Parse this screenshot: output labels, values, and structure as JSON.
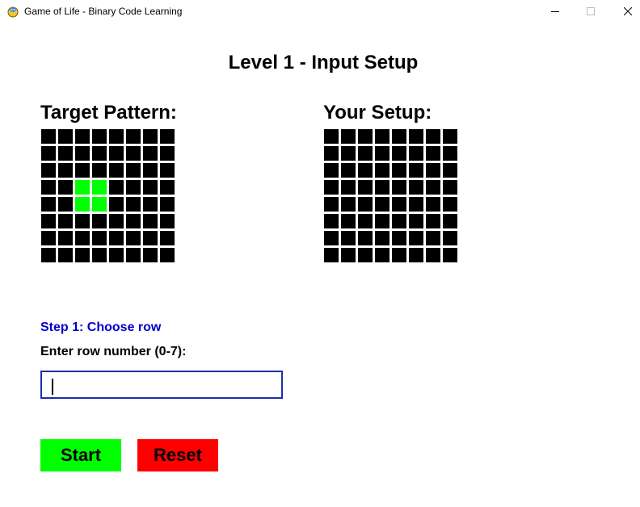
{
  "window": {
    "title": "Game of Life - Binary Code Learning",
    "icon": "pygame-snake-icon"
  },
  "page": {
    "title": "Level 1 - Input Setup"
  },
  "target_grid": {
    "label": "Target Pattern:",
    "size": 8,
    "dead_color": "#000000",
    "alive_color": "#00ff00",
    "cells": [
      [
        0,
        0,
        0,
        0,
        0,
        0,
        0,
        0
      ],
      [
        0,
        0,
        0,
        0,
        0,
        0,
        0,
        0
      ],
      [
        0,
        0,
        0,
        0,
        0,
        0,
        0,
        0
      ],
      [
        0,
        0,
        1,
        1,
        0,
        0,
        0,
        0
      ],
      [
        0,
        0,
        1,
        1,
        0,
        0,
        0,
        0
      ],
      [
        0,
        0,
        0,
        0,
        0,
        0,
        0,
        0
      ],
      [
        0,
        0,
        0,
        0,
        0,
        0,
        0,
        0
      ],
      [
        0,
        0,
        0,
        0,
        0,
        0,
        0,
        0
      ]
    ]
  },
  "setup_grid": {
    "label": "Your Setup:",
    "size": 8,
    "cells": [
      [
        0,
        0,
        0,
        0,
        0,
        0,
        0,
        0
      ],
      [
        0,
        0,
        0,
        0,
        0,
        0,
        0,
        0
      ],
      [
        0,
        0,
        0,
        0,
        0,
        0,
        0,
        0
      ],
      [
        0,
        0,
        0,
        0,
        0,
        0,
        0,
        0
      ],
      [
        0,
        0,
        0,
        0,
        0,
        0,
        0,
        0
      ],
      [
        0,
        0,
        0,
        0,
        0,
        0,
        0,
        0
      ],
      [
        0,
        0,
        0,
        0,
        0,
        0,
        0,
        0
      ],
      [
        0,
        0,
        0,
        0,
        0,
        0,
        0,
        0
      ]
    ]
  },
  "input": {
    "step_label": "Step 1: Choose row",
    "prompt": "Enter row number (0-7):",
    "value": ""
  },
  "buttons": {
    "start": "Start",
    "reset": "Reset",
    "start_color": "#00ff00",
    "reset_color": "#ff0000"
  }
}
